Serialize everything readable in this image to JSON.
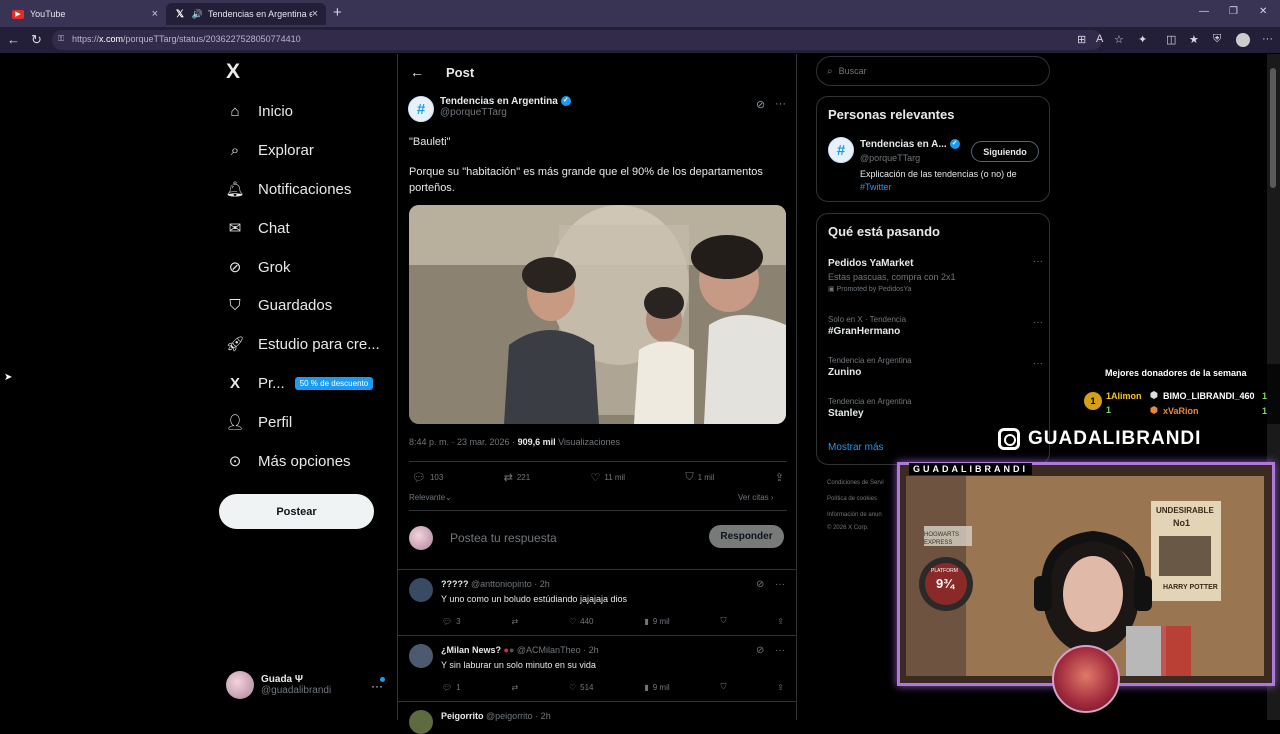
{
  "browser": {
    "tabs": [
      {
        "label": "YouTube",
        "close": "×"
      },
      {
        "label": "Tendencias en Argentina en X",
        "close": "×"
      }
    ],
    "new_tab": "+",
    "url_prefix": "https://",
    "url_domain": "x.com",
    "url_path": "/porqueTTarg/status/2036227528050774410"
  },
  "sidebar": {
    "logo": "X",
    "items": [
      {
        "label": "Inicio",
        "icon": "home-icon"
      },
      {
        "label": "Explorar",
        "icon": "search-icon"
      },
      {
        "label": "Notificaciones",
        "icon": "bell-icon"
      },
      {
        "label": "Chat",
        "icon": "mail-icon"
      },
      {
        "label": "Grok",
        "icon": "grok-icon"
      },
      {
        "label": "Guardados",
        "icon": "bookmark-icon"
      },
      {
        "label": "Estudio para cre...",
        "icon": "rocket-icon"
      },
      {
        "label": "Pr...",
        "icon": "x-premium-icon",
        "badge": "50 % de descuento"
      },
      {
        "label": "Perfil",
        "icon": "person-icon"
      },
      {
        "label": "Más opciones",
        "icon": "more-circle-icon"
      }
    ],
    "post_button": "Postear",
    "account": {
      "name": "Guada Ψ",
      "handle": "@guadalibrandi",
      "more": "···"
    }
  },
  "post": {
    "header": "Post",
    "back": "←",
    "author_name": "Tendencias en Argentina",
    "author_handle": "@porqueTTarg",
    "verified_mark": "✓",
    "text_line1": "\"Bauleti\"",
    "text_line2": "Porque su \"habitación\" es más grande que el 90% de los departamentos porteños.",
    "time": "8:44 p. m. · 23 mar. 2026 · ",
    "views_count": "909,6 mil",
    "views_label": " Visualizaciones",
    "stats": {
      "replies": "103",
      "reposts": "221",
      "likes": "11 mil",
      "bookmarks": "1 mil"
    },
    "sort_label": "Relevante",
    "quotes_label": "Ver citas",
    "reply_placeholder": "Postea tu respuesta",
    "reply_button": "Responder"
  },
  "replies": [
    {
      "name": "?????",
      "handle": "@anttoniopinto · 2h",
      "text": "Y uno como un boludo estúdiando jajajaja dios",
      "replies": "3",
      "reposts": "",
      "likes": "440",
      "views": "9 mil"
    },
    {
      "name": "¿Milan News?",
      "handle": "@ACMilanTheo · 2h",
      "text": "Y sin laburar un solo minuto en su vida",
      "replies": "1",
      "reposts": "",
      "likes": "514",
      "views": "9 mil"
    },
    {
      "name": "Peigorrito",
      "handle": "@peigorrito · 2h",
      "text": "",
      "replies": "",
      "reposts": "",
      "likes": "",
      "views": ""
    }
  ],
  "right": {
    "search_placeholder": "Buscar",
    "relevant_title": "Personas relevantes",
    "relevant": {
      "name": "Tendencias en A...",
      "handle": "@porqueTTarg",
      "follow_label": "Siguiendo",
      "bio": "Explicación de las tendencias (o no) de ",
      "bio_link": "#Twitter"
    },
    "trends_title": "Qué está pasando",
    "trends": [
      {
        "context": "",
        "title": "Pedidos YaMarket",
        "sub": "Estas pascuas, compra con 2x1",
        "promo": "Promoted by PedidosYa"
      },
      {
        "context": "Solo en X · Tendencia",
        "title": "#GranHermano",
        "sub": "",
        "promo": ""
      },
      {
        "context": "Tendencia en Argentina",
        "title": "Zunino",
        "sub": "",
        "promo": ""
      },
      {
        "context": "Tendencia en Argentina",
        "title": "Stanley",
        "sub": "",
        "promo": ""
      }
    ],
    "trend_more": "···",
    "show_more": "Mostrar más",
    "footer": [
      "Condiciones de Servi",
      "Política de cookies",
      "Información de anun",
      "© 2026 X Corp."
    ]
  },
  "overlay": {
    "donors_title": "Mejores donadores de la semana",
    "medal": "1",
    "donor1": "1Alimon",
    "donor1_count": "1",
    "donor2": "BIMO_LIBRANDI_460",
    "donor2_count": "1",
    "donor3": "xVaRion",
    "donor3_count": "1",
    "streamer": "GUADALIBRANDI",
    "cam_tag": "GUADALIBRANDI",
    "poster1": "UNDESIRABLE",
    "poster2": "No1",
    "poster3": "HARRY POTTER",
    "sign1": "HOGWARTS EXPRESS",
    "sign2": "PLATFORM",
    "sign3": "9¾"
  }
}
